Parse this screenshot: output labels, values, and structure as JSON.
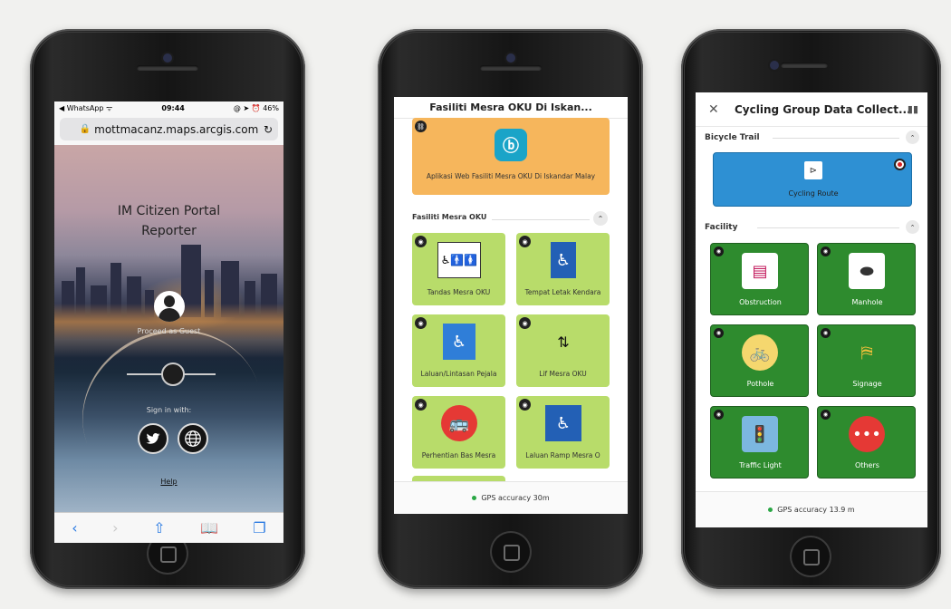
{
  "phone1": {
    "status": {
      "carrier": "◀ WhatsApp ᯤ",
      "time": "09:44",
      "indicators": "@ ➤ ⏰ 46%"
    },
    "url": "mottmacanz.maps.arcgis.com",
    "title_line1": "IM Citizen Portal",
    "title_line2": "Reporter",
    "proceed_label": "Proceed as Guest",
    "sign_in_label": "Sign in with:",
    "help_label": "Help",
    "toolbar": [
      "back-icon",
      "forward-icon",
      "share-icon",
      "bookmarks-icon",
      "tabs-icon"
    ]
  },
  "phone2": {
    "header_title": "Fasiliti Mesra OKU Di Iskan...",
    "web_app_label": "Aplikasi Web Fasiliti Mesra OKU Di Iskandar Malay",
    "group_label": "Fasiliti Mesra OKU",
    "tiles": [
      {
        "label": "Tandas Mesra OKU",
        "icon_text": "TANDAS"
      },
      {
        "label": "Tempat Letak Kendara",
        "icon_text": "Parking"
      },
      {
        "label": "Laluan/Lintasan Pejala",
        "icon_text": ""
      },
      {
        "label": "Lif Mesra OKU",
        "icon_text": ""
      },
      {
        "label": "Perhentian Bas Mesra",
        "icon_text": ""
      },
      {
        "label": "Laluan Ramp Mesra O",
        "icon_text": ""
      }
    ],
    "gps": "GPS accuracy 30m",
    "colors": {
      "web_app": "#f6b65c",
      "tile": "#b8dc6a"
    }
  },
  "phone3": {
    "header_title": "Cycling Group Data Collect...",
    "group1": "Bicycle Trail",
    "route_label": "Cycling Route",
    "group2": "Facility",
    "tiles": [
      {
        "label": "Obstruction"
      },
      {
        "label": "Manhole"
      },
      {
        "label": "Pothole"
      },
      {
        "label": "Signage"
      },
      {
        "label": "Traffic Light"
      },
      {
        "label": "Others"
      }
    ],
    "gps": "GPS accuracy 13.9 m",
    "colors": {
      "route": "#2e90d3",
      "tile": "#2e8b2e"
    }
  }
}
